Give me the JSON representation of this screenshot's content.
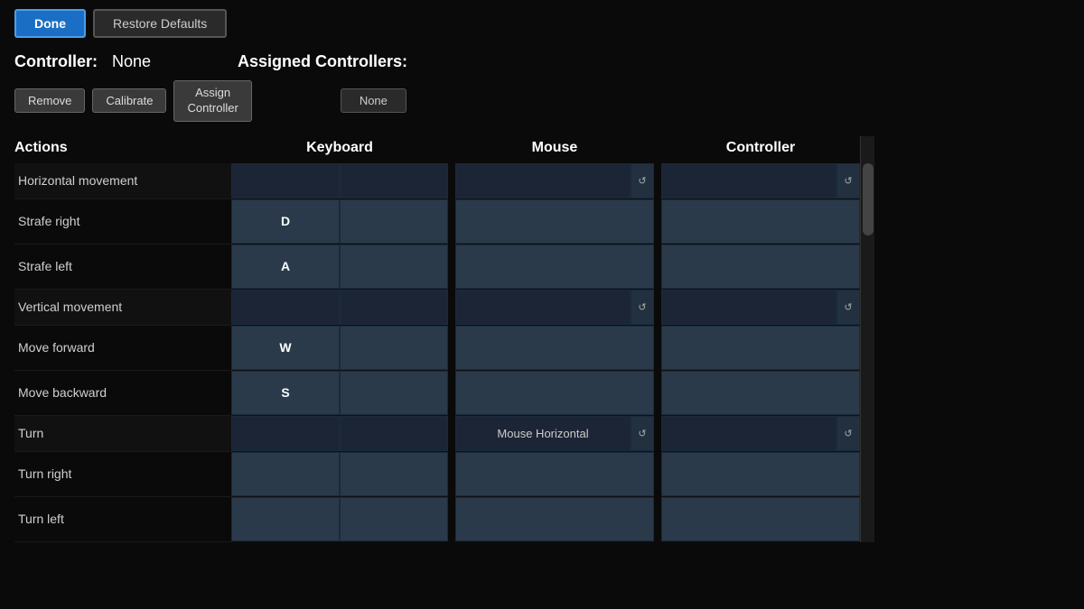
{
  "topbar": {
    "done_label": "Done",
    "restore_label": "Restore Defaults"
  },
  "controller_section": {
    "label": "Controller:",
    "value": "None",
    "remove_label": "Remove",
    "calibrate_label": "Calibrate",
    "assign_label": "Assign\nController",
    "assigned_label": "Assigned Controllers:",
    "assigned_value": "None"
  },
  "columns": {
    "actions": "Actions",
    "keyboard": "Keyboard",
    "mouse": "Mouse",
    "controller": "Controller"
  },
  "actions": [
    {
      "name": "Horizontal movement",
      "is_axis": true
    },
    {
      "name": "Strafe right",
      "is_axis": false
    },
    {
      "name": "Strafe left",
      "is_axis": false
    },
    {
      "name": "Vertical movement",
      "is_axis": true
    },
    {
      "name": "Move forward",
      "is_axis": false
    },
    {
      "name": "Move backward",
      "is_axis": false
    },
    {
      "name": "Turn",
      "is_axis": true
    },
    {
      "name": "Turn right",
      "is_axis": false
    },
    {
      "name": "Turn left",
      "is_axis": false
    }
  ],
  "keyboard_bindings": [
    {
      "key1": "",
      "key2": "",
      "is_axis": true
    },
    {
      "key1": "D",
      "key2": "",
      "is_axis": false
    },
    {
      "key1": "A",
      "key2": "",
      "is_axis": false
    },
    {
      "key1": "",
      "key2": "",
      "is_axis": true
    },
    {
      "key1": "W",
      "key2": "",
      "is_axis": false
    },
    {
      "key1": "S",
      "key2": "",
      "is_axis": false
    },
    {
      "key1": "",
      "key2": "",
      "is_axis": true
    },
    {
      "key1": "",
      "key2": "",
      "is_axis": false
    },
    {
      "key1": "",
      "key2": "",
      "is_axis": false
    }
  ],
  "mouse_bindings": [
    {
      "value": "",
      "is_axis": true,
      "show_icon": true
    },
    {
      "value": "",
      "is_axis": false,
      "show_icon": false
    },
    {
      "value": "",
      "is_axis": false,
      "show_icon": false
    },
    {
      "value": "",
      "is_axis": true,
      "show_icon": true
    },
    {
      "value": "",
      "is_axis": false,
      "show_icon": false
    },
    {
      "value": "",
      "is_axis": false,
      "show_icon": false
    },
    {
      "value": "Mouse Horizontal",
      "is_axis": true,
      "show_icon": true
    },
    {
      "value": "",
      "is_axis": false,
      "show_icon": false
    },
    {
      "value": "",
      "is_axis": false,
      "show_icon": false
    }
  ],
  "controller_bindings": [
    {
      "value": "",
      "is_axis": true,
      "show_icon": true
    },
    {
      "value": "",
      "is_axis": false,
      "show_icon": false
    },
    {
      "value": "",
      "is_axis": false,
      "show_icon": false
    },
    {
      "value": "",
      "is_axis": true,
      "show_icon": true
    },
    {
      "value": "",
      "is_axis": false,
      "show_icon": false
    },
    {
      "value": "",
      "is_axis": false,
      "show_icon": false
    },
    {
      "value": "",
      "is_axis": true,
      "show_icon": true
    },
    {
      "value": "",
      "is_axis": false,
      "show_icon": false
    },
    {
      "value": "",
      "is_axis": false,
      "show_icon": false
    }
  ],
  "refresh_icon_char": "↺"
}
